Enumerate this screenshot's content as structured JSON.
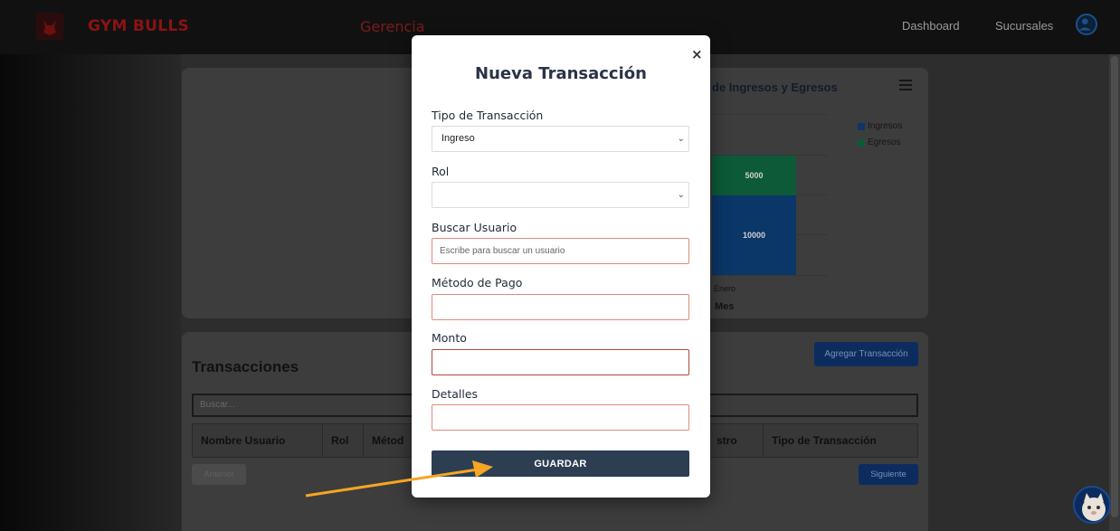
{
  "nav": {
    "brand": "GYM BULLS",
    "section": "Gerencia",
    "links": [
      "Dashboard",
      "Sucursales"
    ]
  },
  "chart_data": {
    "type": "bar",
    "title": "de Ingresos y Egresos",
    "categories": [
      "Enero"
    ],
    "series": [
      {
        "name": "Ingresos",
        "values": [
          10000
        ],
        "color": "#0d6efd"
      },
      {
        "name": "Egresos",
        "values": [
          5000
        ],
        "color": "#20c997"
      }
    ],
    "stacked": true,
    "xlabel": "Mes",
    "legend": "top-right"
  },
  "transactions": {
    "title": "Transacciones",
    "add_button": "Agregar Transacción",
    "search_placeholder": "Buscar...",
    "columns": [
      "Nombre Usuario",
      "Rol",
      "Métod",
      "stro",
      "Tipo de Transacción"
    ],
    "prev_button": "Anterior",
    "next_button": "Siguiente"
  },
  "modal": {
    "close": "×",
    "title": "Nueva Transacción",
    "fields": {
      "tipo_label": "Tipo de Transacción",
      "tipo_value": "Ingreso",
      "rol_label": "Rol",
      "rol_value": "",
      "usuario_label": "Buscar Usuario",
      "usuario_placeholder": "Escribe para buscar un usuario",
      "metodo_label": "Método de Pago",
      "monto_label": "Monto",
      "detalles_label": "Detalles"
    },
    "save_button": "GUARDAR"
  },
  "icons": {
    "chevron": "chevron-down-icon",
    "user": "user-circle-icon",
    "menu": "hamburger-icon"
  }
}
